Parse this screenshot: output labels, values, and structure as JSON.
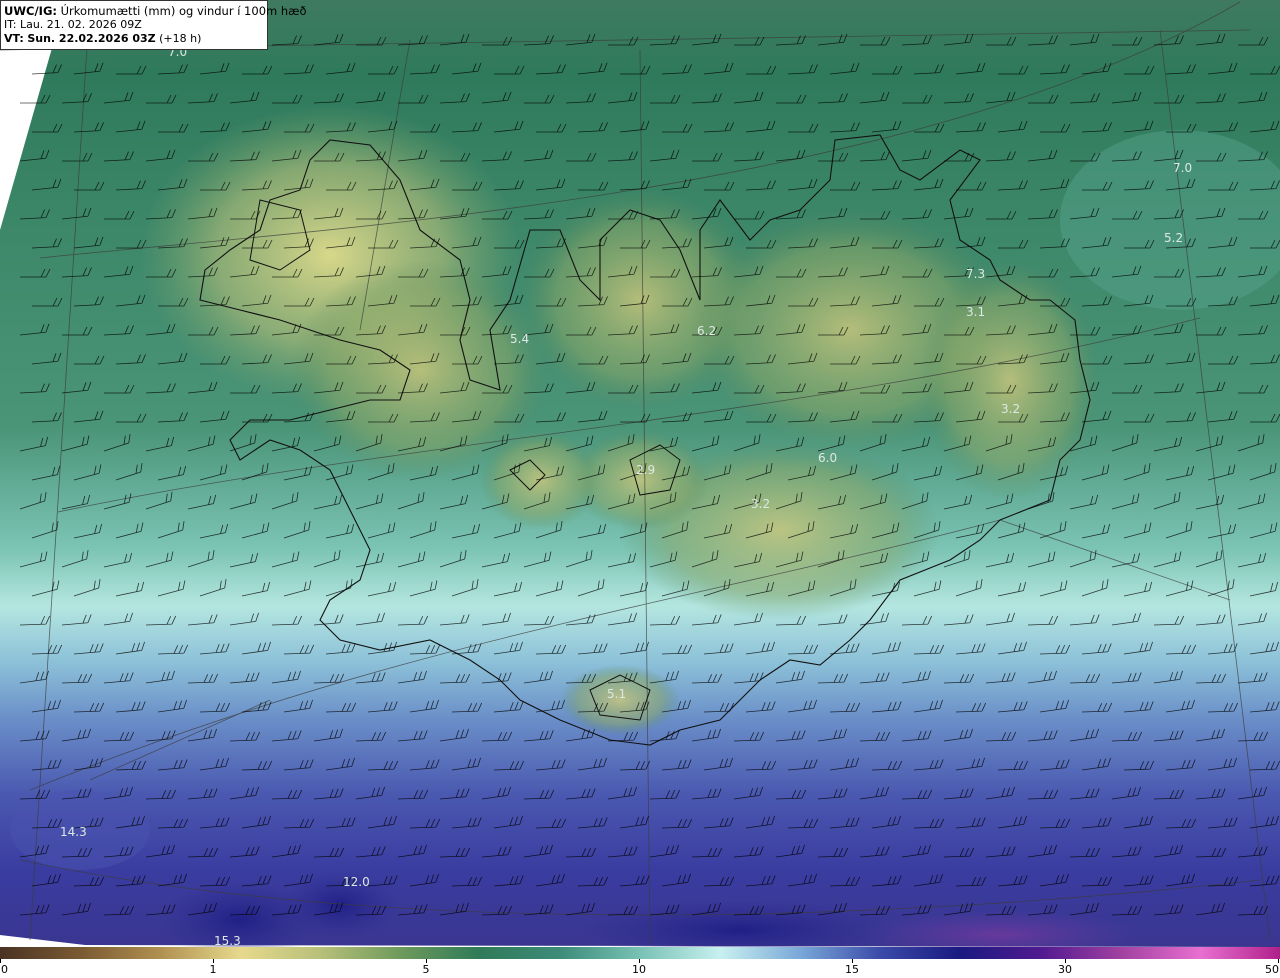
{
  "header": {
    "product": "UWC/IG:",
    "title": "Úrkomumætti (mm) og vindur í 100m hæð",
    "it_label": "IT:",
    "it_value": "Lau. 21. 02. 2026 09Z",
    "vt_label": "VT:",
    "vt_value": "Sun. 22.02.2026 03Z",
    "vt_lead": "(+18 h)"
  },
  "map_labels": [
    {
      "text": "7.0"
    },
    {
      "text": "7.0"
    },
    {
      "text": "5.2"
    },
    {
      "text": "7.3"
    },
    {
      "text": "3.1"
    },
    {
      "text": "5.4"
    },
    {
      "text": "6.2"
    },
    {
      "text": "3.2"
    },
    {
      "text": "2.9"
    },
    {
      "text": "6.0"
    },
    {
      "text": "3.2"
    },
    {
      "text": "5.1"
    },
    {
      "text": "14.3"
    },
    {
      "text": "12.0"
    },
    {
      "text": "15.3"
    }
  ],
  "colorbar": {
    "ticks": [
      {
        "label": "0",
        "value": 0
      },
      {
        "label": "1",
        "value": 1
      },
      {
        "label": "5",
        "value": 5
      },
      {
        "label": "10",
        "value": 10
      },
      {
        "label": "15",
        "value": 15
      },
      {
        "label": "30",
        "value": 30
      },
      {
        "label": "50",
        "value": 50
      }
    ],
    "colors": [
      "#4a3324",
      "#7a5a32",
      "#b09050",
      "#e6d98c",
      "#b8c07a",
      "#6e9a5c",
      "#2f7a58",
      "#3d8c7a",
      "#78c2b4",
      "#c8f0f0",
      "#7aa8d8",
      "#3a4aa8",
      "#1a1a80",
      "#501a90",
      "#a040a0",
      "#e870d0",
      "#b0208a"
    ]
  },
  "colors": {
    "land_high": "#d8d68a",
    "land_mid": "#8aab6a",
    "sea_north": "#3f7d65",
    "sea_south": "#3848a8",
    "wind_barb": "#000000"
  }
}
